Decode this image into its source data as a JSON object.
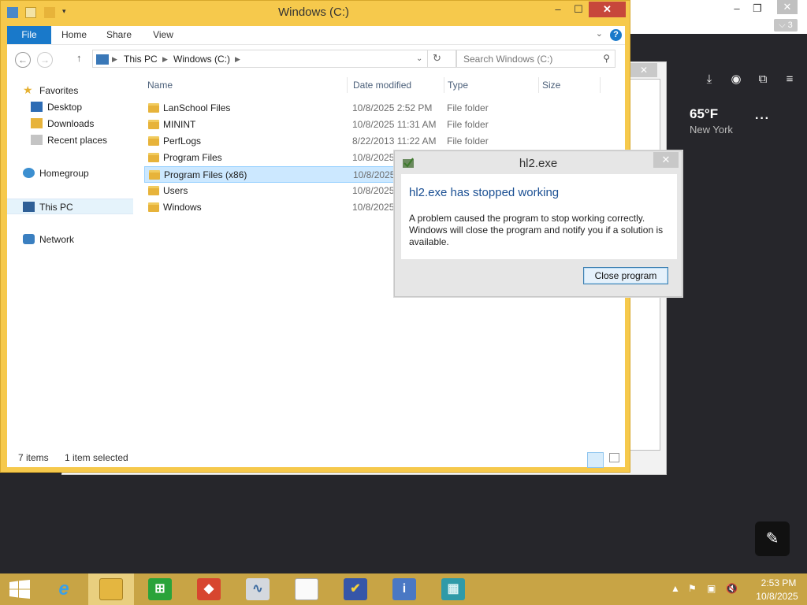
{
  "explorer": {
    "title": "Windows (C:)",
    "ribbon_tabs": [
      {
        "label": "File"
      },
      {
        "label": "Home"
      },
      {
        "label": "Share"
      },
      {
        "label": "View"
      }
    ],
    "breadcrumb": [
      "This PC",
      "Windows (C:)"
    ],
    "search_placeholder": "Search Windows (C:)",
    "nav": {
      "favorites": "Favorites",
      "desktop": "Desktop",
      "downloads": "Downloads",
      "recent": "Recent places",
      "homegroup": "Homegroup",
      "thispc": "This PC",
      "network": "Network"
    },
    "columns": {
      "name": "Name",
      "date": "Date modified",
      "type": "Type",
      "size": "Size"
    },
    "rows": [
      {
        "name": "LanSchool Files",
        "date": "10/8/2025 2:52 PM",
        "type": "File folder"
      },
      {
        "name": "MININT",
        "date": "10/8/2025 11:31 AM",
        "type": "File folder"
      },
      {
        "name": "PerfLogs",
        "date": "8/22/2013 11:22 AM",
        "type": "File folder"
      },
      {
        "name": "Program Files",
        "date": "10/8/2025",
        "type": ""
      },
      {
        "name": "Program Files (x86)",
        "date": "10/8/2025",
        "type": ""
      },
      {
        "name": "Users",
        "date": "10/8/2025",
        "type": ""
      },
      {
        "name": "Windows",
        "date": "10/8/2025",
        "type": ""
      }
    ],
    "status": {
      "count": "7 items",
      "selected": "1 item selected"
    }
  },
  "dialog": {
    "title": "hl2.exe",
    "heading": "hl2.exe has stopped working",
    "message": "A problem caused the program to stop working correctly. Windows will close the program and notify you if a solution is available.",
    "button": "Close program"
  },
  "background": {
    "tab_count": "3",
    "temperature": "65°F",
    "city": "New York"
  },
  "taskbar": {
    "time": "2:53 PM",
    "date": "10/8/2025"
  },
  "colors": {
    "accent": "#1979ca",
    "window_frame": "#f6c94c",
    "taskbar": "#c8a445",
    "close_red": "#c7473b",
    "selection": "#cce8ff"
  }
}
